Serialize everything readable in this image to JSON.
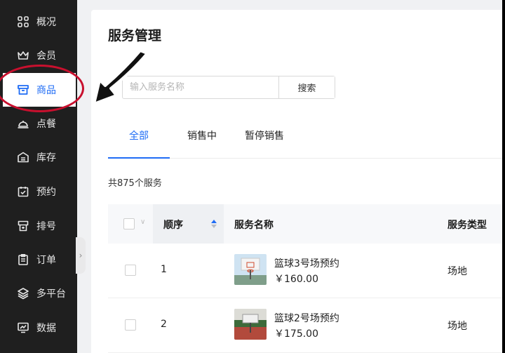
{
  "sidebar": {
    "items": [
      {
        "label": "概况",
        "icon": "grid-icon"
      },
      {
        "label": "会员",
        "icon": "crown-icon"
      },
      {
        "label": "商品",
        "icon": "store-icon",
        "active": true
      },
      {
        "label": "点餐",
        "icon": "cloche-icon"
      },
      {
        "label": "库存",
        "icon": "warehouse-icon"
      },
      {
        "label": "预约",
        "icon": "calendar-check-icon"
      },
      {
        "label": "排号",
        "icon": "queue-icon"
      },
      {
        "label": "订单",
        "icon": "clipboard-icon"
      },
      {
        "label": "多平台",
        "icon": "layers-icon"
      },
      {
        "label": "数据",
        "icon": "chart-monitor-icon"
      }
    ]
  },
  "page": {
    "title": "服务管理"
  },
  "search": {
    "placeholder": "输入服务名称",
    "button_label": "搜索"
  },
  "tabs": [
    {
      "label": "全部",
      "active": true
    },
    {
      "label": "销售中"
    },
    {
      "label": "暂停销售"
    }
  ],
  "total_text": "共875个服务",
  "table": {
    "headers": {
      "order": "顺序",
      "name": "服务名称",
      "type": "服务类型"
    },
    "rows": [
      {
        "order": "1",
        "name": "篮球3号场预约",
        "price": "￥160.00",
        "type": "场地"
      },
      {
        "order": "2",
        "name": "篮球2号场预约",
        "price": "￥175.00",
        "type": "场地"
      }
    ]
  },
  "colors": {
    "accent": "#1f6cf5",
    "sidebar_bg": "#1f1f1f",
    "annotation": "#c8102e"
  }
}
